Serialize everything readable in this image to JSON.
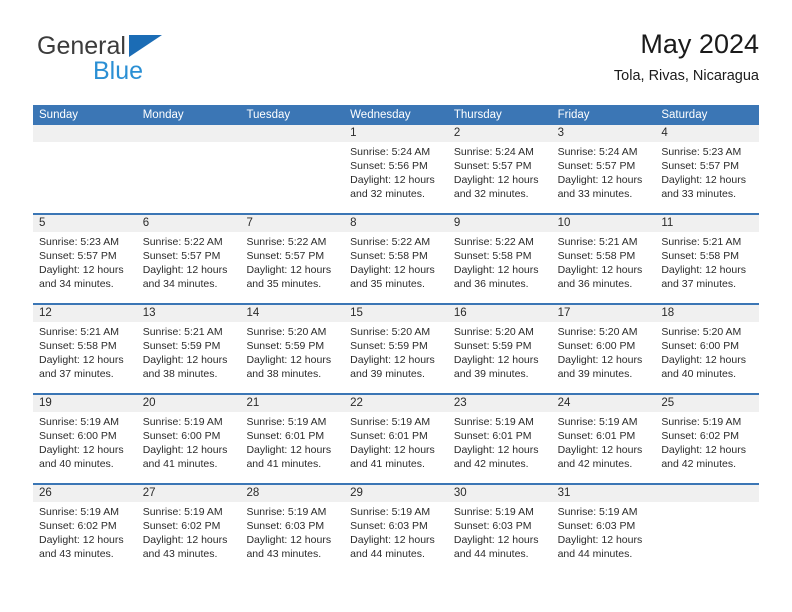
{
  "brand": {
    "name_top": "General",
    "name_bottom": "Blue",
    "triangle_icon": "triangle-icon",
    "color_top": "#3c3c3c",
    "color_bottom": "#2a8fd4",
    "accent": "#1b6cb5"
  },
  "header": {
    "title": "May 2024",
    "subtitle": "Tola, Rivas, Nicaragua"
  },
  "calendar": {
    "header_bg": "#3b76b5",
    "header_text_color": "#ffffff",
    "daynum_bg": "#f0f0f0",
    "weekdays": [
      "Sunday",
      "Monday",
      "Tuesday",
      "Wednesday",
      "Thursday",
      "Friday",
      "Saturday"
    ],
    "weeks": [
      [
        {
          "day": "",
          "lines": []
        },
        {
          "day": "",
          "lines": []
        },
        {
          "day": "",
          "lines": []
        },
        {
          "day": "1",
          "lines": [
            "Sunrise: 5:24 AM",
            "Sunset: 5:56 PM",
            "Daylight: 12 hours",
            "and 32 minutes."
          ]
        },
        {
          "day": "2",
          "lines": [
            "Sunrise: 5:24 AM",
            "Sunset: 5:57 PM",
            "Daylight: 12 hours",
            "and 32 minutes."
          ]
        },
        {
          "day": "3",
          "lines": [
            "Sunrise: 5:24 AM",
            "Sunset: 5:57 PM",
            "Daylight: 12 hours",
            "and 33 minutes."
          ]
        },
        {
          "day": "4",
          "lines": [
            "Sunrise: 5:23 AM",
            "Sunset: 5:57 PM",
            "Daylight: 12 hours",
            "and 33 minutes."
          ]
        }
      ],
      [
        {
          "day": "5",
          "lines": [
            "Sunrise: 5:23 AM",
            "Sunset: 5:57 PM",
            "Daylight: 12 hours",
            "and 34 minutes."
          ]
        },
        {
          "day": "6",
          "lines": [
            "Sunrise: 5:22 AM",
            "Sunset: 5:57 PM",
            "Daylight: 12 hours",
            "and 34 minutes."
          ]
        },
        {
          "day": "7",
          "lines": [
            "Sunrise: 5:22 AM",
            "Sunset: 5:57 PM",
            "Daylight: 12 hours",
            "and 35 minutes."
          ]
        },
        {
          "day": "8",
          "lines": [
            "Sunrise: 5:22 AM",
            "Sunset: 5:58 PM",
            "Daylight: 12 hours",
            "and 35 minutes."
          ]
        },
        {
          "day": "9",
          "lines": [
            "Sunrise: 5:22 AM",
            "Sunset: 5:58 PM",
            "Daylight: 12 hours",
            "and 36 minutes."
          ]
        },
        {
          "day": "10",
          "lines": [
            "Sunrise: 5:21 AM",
            "Sunset: 5:58 PM",
            "Daylight: 12 hours",
            "and 36 minutes."
          ]
        },
        {
          "day": "11",
          "lines": [
            "Sunrise: 5:21 AM",
            "Sunset: 5:58 PM",
            "Daylight: 12 hours",
            "and 37 minutes."
          ]
        }
      ],
      [
        {
          "day": "12",
          "lines": [
            "Sunrise: 5:21 AM",
            "Sunset: 5:58 PM",
            "Daylight: 12 hours",
            "and 37 minutes."
          ]
        },
        {
          "day": "13",
          "lines": [
            "Sunrise: 5:21 AM",
            "Sunset: 5:59 PM",
            "Daylight: 12 hours",
            "and 38 minutes."
          ]
        },
        {
          "day": "14",
          "lines": [
            "Sunrise: 5:20 AM",
            "Sunset: 5:59 PM",
            "Daylight: 12 hours",
            "and 38 minutes."
          ]
        },
        {
          "day": "15",
          "lines": [
            "Sunrise: 5:20 AM",
            "Sunset: 5:59 PM",
            "Daylight: 12 hours",
            "and 39 minutes."
          ]
        },
        {
          "day": "16",
          "lines": [
            "Sunrise: 5:20 AM",
            "Sunset: 5:59 PM",
            "Daylight: 12 hours",
            "and 39 minutes."
          ]
        },
        {
          "day": "17",
          "lines": [
            "Sunrise: 5:20 AM",
            "Sunset: 6:00 PM",
            "Daylight: 12 hours",
            "and 39 minutes."
          ]
        },
        {
          "day": "18",
          "lines": [
            "Sunrise: 5:20 AM",
            "Sunset: 6:00 PM",
            "Daylight: 12 hours",
            "and 40 minutes."
          ]
        }
      ],
      [
        {
          "day": "19",
          "lines": [
            "Sunrise: 5:19 AM",
            "Sunset: 6:00 PM",
            "Daylight: 12 hours",
            "and 40 minutes."
          ]
        },
        {
          "day": "20",
          "lines": [
            "Sunrise: 5:19 AM",
            "Sunset: 6:00 PM",
            "Daylight: 12 hours",
            "and 41 minutes."
          ]
        },
        {
          "day": "21",
          "lines": [
            "Sunrise: 5:19 AM",
            "Sunset: 6:01 PM",
            "Daylight: 12 hours",
            "and 41 minutes."
          ]
        },
        {
          "day": "22",
          "lines": [
            "Sunrise: 5:19 AM",
            "Sunset: 6:01 PM",
            "Daylight: 12 hours",
            "and 41 minutes."
          ]
        },
        {
          "day": "23",
          "lines": [
            "Sunrise: 5:19 AM",
            "Sunset: 6:01 PM",
            "Daylight: 12 hours",
            "and 42 minutes."
          ]
        },
        {
          "day": "24",
          "lines": [
            "Sunrise: 5:19 AM",
            "Sunset: 6:01 PM",
            "Daylight: 12 hours",
            "and 42 minutes."
          ]
        },
        {
          "day": "25",
          "lines": [
            "Sunrise: 5:19 AM",
            "Sunset: 6:02 PM",
            "Daylight: 12 hours",
            "and 42 minutes."
          ]
        }
      ],
      [
        {
          "day": "26",
          "lines": [
            "Sunrise: 5:19 AM",
            "Sunset: 6:02 PM",
            "Daylight: 12 hours",
            "and 43 minutes."
          ]
        },
        {
          "day": "27",
          "lines": [
            "Sunrise: 5:19 AM",
            "Sunset: 6:02 PM",
            "Daylight: 12 hours",
            "and 43 minutes."
          ]
        },
        {
          "day": "28",
          "lines": [
            "Sunrise: 5:19 AM",
            "Sunset: 6:03 PM",
            "Daylight: 12 hours",
            "and 43 minutes."
          ]
        },
        {
          "day": "29",
          "lines": [
            "Sunrise: 5:19 AM",
            "Sunset: 6:03 PM",
            "Daylight: 12 hours",
            "and 44 minutes."
          ]
        },
        {
          "day": "30",
          "lines": [
            "Sunrise: 5:19 AM",
            "Sunset: 6:03 PM",
            "Daylight: 12 hours",
            "and 44 minutes."
          ]
        },
        {
          "day": "31",
          "lines": [
            "Sunrise: 5:19 AM",
            "Sunset: 6:03 PM",
            "Daylight: 12 hours",
            "and 44 minutes."
          ]
        },
        {
          "day": "",
          "lines": []
        }
      ]
    ]
  }
}
